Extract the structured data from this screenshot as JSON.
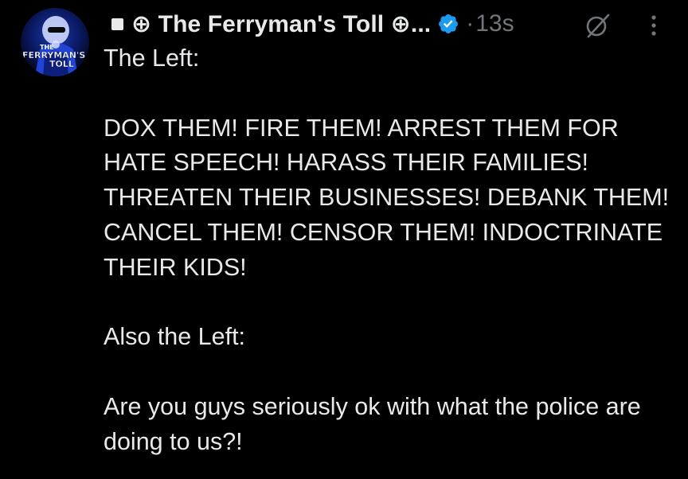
{
  "post": {
    "author": {
      "display_name": "⊕ The Ferryman's Toll ⊕...",
      "avatar_text_top": "THE",
      "avatar_text_mid": "FERRYMAN'S",
      "avatar_text_bottom": "TOLL",
      "verified": true
    },
    "separator": "·",
    "timestamp": "13s",
    "text_paragraphs": {
      "p1": "The Left:",
      "p2": "DOX THEM! FIRE THEM! ARREST THEM FOR HATE SPEECH! HARASS THEIR FAMILIES! THREATEN THEIR BUSINESSES! DEBANK THEM! CANCEL THEM! CENSOR THEM! INDOCTRINATE THEIR KIDS!",
      "p3": "Also the Left:",
      "p4": "Are you guys seriously ok with what the police are doing to us?!"
    }
  },
  "icons": {
    "square": "square-badge-icon",
    "verified": "verified-badge-icon",
    "grok": "grok-icon",
    "more": "more-options-icon"
  },
  "colors": {
    "background": "#000000",
    "text_primary": "#e7e9ea",
    "text_secondary": "#71767b",
    "verified_blue": "#1d9bf0"
  }
}
